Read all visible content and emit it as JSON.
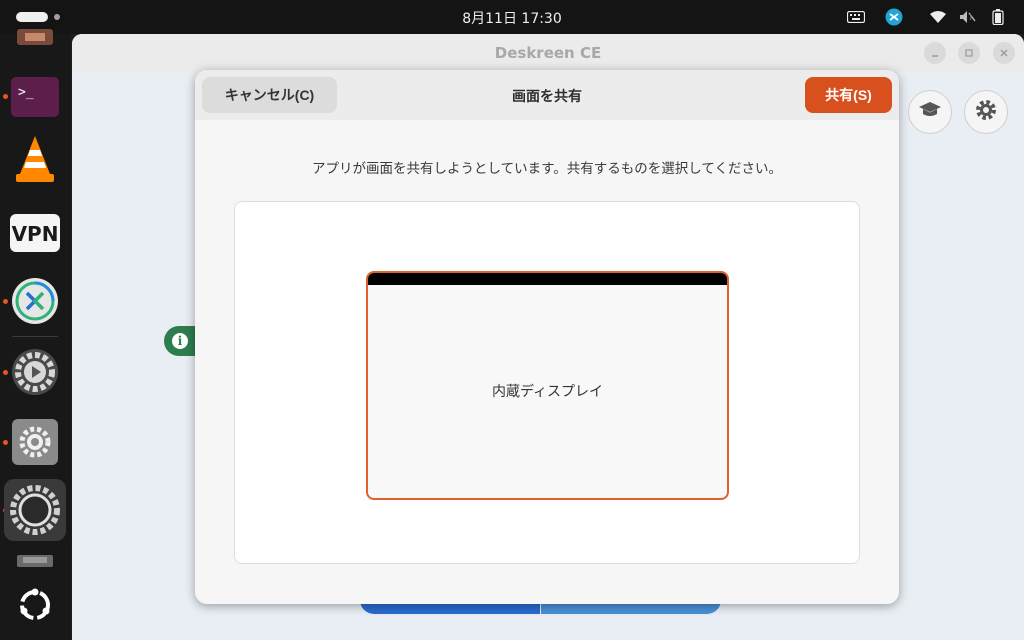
{
  "topbar": {
    "clock": "8月11日  17:30",
    "tray_icons": [
      "keyboard-icon",
      "remote-desktop-icon",
      "wifi-icon",
      "volume-muted-icon",
      "battery-icon"
    ]
  },
  "dock": {
    "apps": [
      {
        "name": "app-partial-top",
        "running": false
      },
      {
        "name": "terminal",
        "icon_text": ">_",
        "running": true
      },
      {
        "name": "vlc",
        "running": false
      },
      {
        "name": "vpn",
        "icon_text": "VPN",
        "running": false
      },
      {
        "name": "remote-desktop",
        "running": true
      },
      {
        "name": "settings-video",
        "running": true
      },
      {
        "name": "settings",
        "running": true
      },
      {
        "name": "deskreen",
        "running": true
      },
      {
        "name": "app-partial-bottom",
        "running": false
      },
      {
        "name": "show-apps",
        "running": false
      }
    ],
    "accent": "#e95420"
  },
  "background_window": {
    "title": "Deskreen CE",
    "controls": [
      "minimize",
      "maximize",
      "close"
    ],
    "toolbar_icons": [
      "graduation-cap-icon",
      "gear-icon"
    ],
    "info_icon": "i"
  },
  "dialog": {
    "title": "画面を共有",
    "cancel_label": "キャンセル(C)",
    "share_label": "共有(S)",
    "instructions": "アプリが画面を共有しようとしています。共有するものを選択してください。",
    "sources": [
      {
        "label": "内蔵ディスプレイ",
        "selected": true
      }
    ],
    "accent": "#d9501f"
  }
}
